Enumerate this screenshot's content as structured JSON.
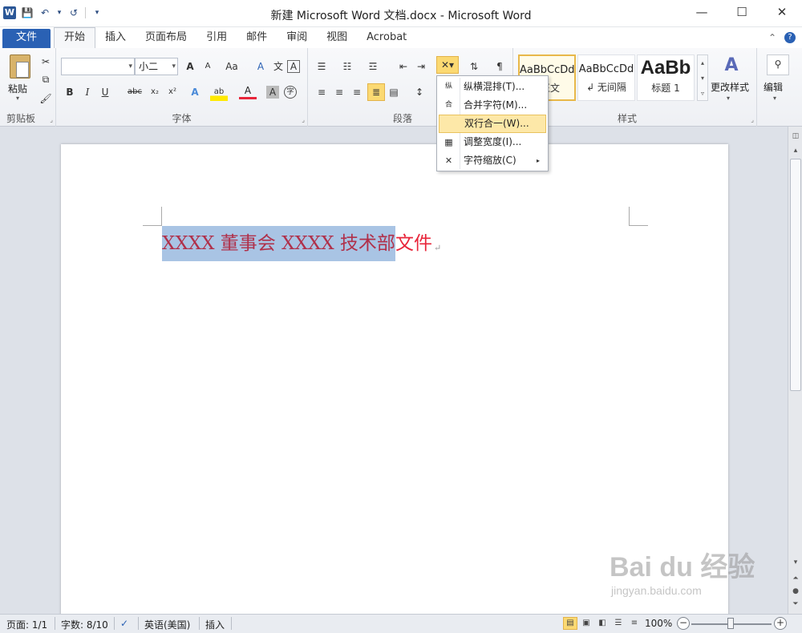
{
  "window": {
    "title": "新建 Microsoft Word 文档.docx - Microsoft Word",
    "logo": "W",
    "controls": {
      "minimize": "—",
      "maximize": "☐",
      "close": "✕"
    }
  },
  "qat": {
    "save": "💾",
    "undo": "↶",
    "undo_dd": "▾",
    "redo": "↺",
    "customize": "▾"
  },
  "tabs": {
    "file": "文件",
    "home": "开始",
    "insert": "插入",
    "layout": "页面布局",
    "references": "引用",
    "mailings": "邮件",
    "review": "审阅",
    "view": "视图",
    "acrobat": "Acrobat"
  },
  "ribbon_right": {
    "minimize": "⌃",
    "help": "?"
  },
  "clipboard": {
    "paste": "粘贴",
    "label": "剪贴板",
    "cut": "✂",
    "copy": "⧉",
    "format_painter": "🖌"
  },
  "font": {
    "name_value": "",
    "size_value": "小二",
    "label": "字体",
    "grow": "A",
    "shrink": "A",
    "case": "Aa",
    "clear": "A",
    "phonetic": "文",
    "char_border": "A",
    "bold": "B",
    "italic": "I",
    "underline": "U",
    "strike": "abc",
    "subscript": "x₂",
    "superscript": "x²",
    "text_effect": "A",
    "highlight": "ab",
    "font_color": "A",
    "char_shading": "A",
    "enclose": "字"
  },
  "paragraph": {
    "label": "段落"
  },
  "styles": {
    "label": "样式",
    "items": [
      {
        "sample": "AaBbCcDd",
        "name": "正文"
      },
      {
        "sample": "AaBbCcDd",
        "name": "↲ 无间隔"
      },
      {
        "sample": "AaBb",
        "name": "标题 1"
      }
    ],
    "change": "更改样式",
    "edit": "编辑"
  },
  "menu": {
    "items": [
      {
        "icon": "纵",
        "label": "纵横混排(T)..."
      },
      {
        "icon": "合",
        "label": "合并字符(M)..."
      },
      {
        "icon": "",
        "label": "双行合一(W)..."
      },
      {
        "icon": "▦",
        "label": "调整宽度(I)..."
      },
      {
        "icon": "✕",
        "label": "字符缩放(C)",
        "submenu": "▸"
      }
    ]
  },
  "document": {
    "selected_text": "XXXX 董事会 XXXX 技术部",
    "unselected_text": "文件",
    "para_mark": "↵"
  },
  "status": {
    "page": "页面: 1/1",
    "words": "字数: 8/10",
    "language": "英语(美国)",
    "mode": "插入",
    "zoom": "100%",
    "zoom_out": "−",
    "zoom_in": "+"
  },
  "watermark": {
    "brand": "Bai du 经验",
    "url": "jingyan.baidu.com"
  }
}
